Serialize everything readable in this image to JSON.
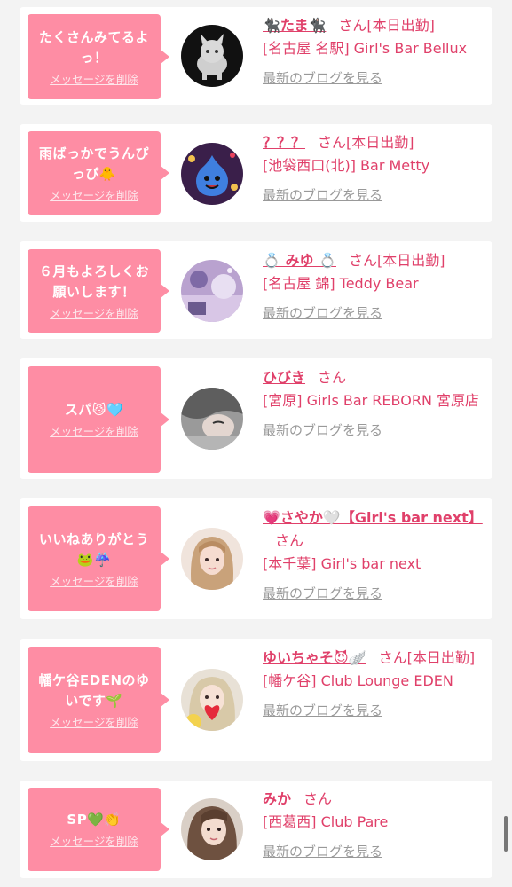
{
  "delete_label": "メッセージを削除",
  "blog_label": "最新のブログを見る",
  "colors": {
    "accent": "#e0406a",
    "bubble": "#fe8da4",
    "link_gray": "#999999"
  },
  "items": [
    {
      "message": "たくさんみてるよっ！",
      "name": "🐈‍⬛たま🐈‍⬛",
      "suffix": "さん[本日出勤]",
      "shop": "[名古屋 名駅] Girl's Bar Bellux",
      "avatar_icon": "wolf-avatar-icon"
    },
    {
      "message": "雨ばっかでうんぴっぴ🐥",
      "name": "？？？",
      "suffix": "さん[本日出勤]",
      "shop": "[池袋西口(北)] Bar Metty",
      "avatar_icon": "slime-avatar-icon"
    },
    {
      "message": "６月もよろしくお願いします！",
      "name": "💍 みゆ 💍",
      "suffix": "さん[本日出勤]",
      "shop": "[名古屋 錦] Teddy Bear",
      "avatar_icon": "girl-avatar-icon"
    },
    {
      "message": "スパ😼🩵",
      "name": "ひびき",
      "suffix": "さん",
      "shop": "[宮原] Girls Bar REBORN 宮原店",
      "avatar_icon": "girl-avatar-icon"
    },
    {
      "message": "いいねありがとう🐸☔️",
      "name": "💗さやか🤍【Girl's bar next】",
      "suffix": "さん",
      "shop": "[本千葉] Girl's bar next",
      "avatar_icon": "girl-avatar-icon"
    },
    {
      "message": "幡ケ谷EDENのゆいです🌱",
      "name": "ゆいちゃそ😈🪽",
      "suffix": "さん[本日出勤]",
      "shop": "[幡ケ谷] Club Lounge EDEN",
      "avatar_icon": "girl-avatar-icon"
    },
    {
      "message": "SP💚👏",
      "name": "みか",
      "suffix": "さん",
      "shop": "[西葛西] Club Pare",
      "avatar_icon": "girl-avatar-icon"
    }
  ]
}
